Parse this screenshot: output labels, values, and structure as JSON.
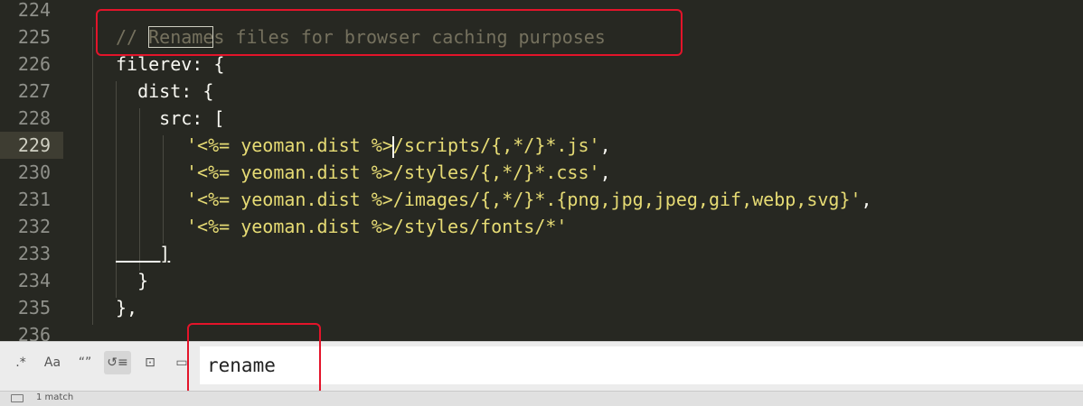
{
  "editor": {
    "lines": [
      {
        "num": "224",
        "text": ""
      },
      {
        "num": "225",
        "pre": "// ",
        "match": "Rename",
        "post": "s files for browser caching purposes"
      },
      {
        "num": "226",
        "text": "filerev: {"
      },
      {
        "num": "227",
        "text": "  dist: {"
      },
      {
        "num": "228",
        "text": "    src: ["
      },
      {
        "num": "229",
        "str_a": "'<%= yeoman.dist %>",
        "str_b": "/scripts/{,*/}*.js'",
        "punct": ","
      },
      {
        "num": "230",
        "str": "'<%= yeoman.dist %>/styles/{,*/}*.css'",
        "punct": ","
      },
      {
        "num": "231",
        "str": "'<%= yeoman.dist %>/images/{,*/}*.{png,jpg,jpeg,gif,webp,svg}'",
        "punct": ","
      },
      {
        "num": "232",
        "str": "'<%= yeoman.dist %>/styles/fonts/*'"
      },
      {
        "num": "233",
        "text": "    ]"
      },
      {
        "num": "234",
        "text": "  }"
      },
      {
        "num": "235",
        "text": "},"
      },
      {
        "num": "236",
        "text": ""
      }
    ]
  },
  "findbar": {
    "regex_label": ".*",
    "case_label": "Aa",
    "whole_word_label": "“”",
    "wrap_label": "↺≡",
    "in_selection_label": "⊡",
    "highlight_label": "▭",
    "query": "rename"
  },
  "status": {
    "match_count": "1 match"
  },
  "colors": {
    "editor_bg": "#272822",
    "comment": "#75715e",
    "string": "#e6db74",
    "annotation_box": "#e3142a"
  }
}
